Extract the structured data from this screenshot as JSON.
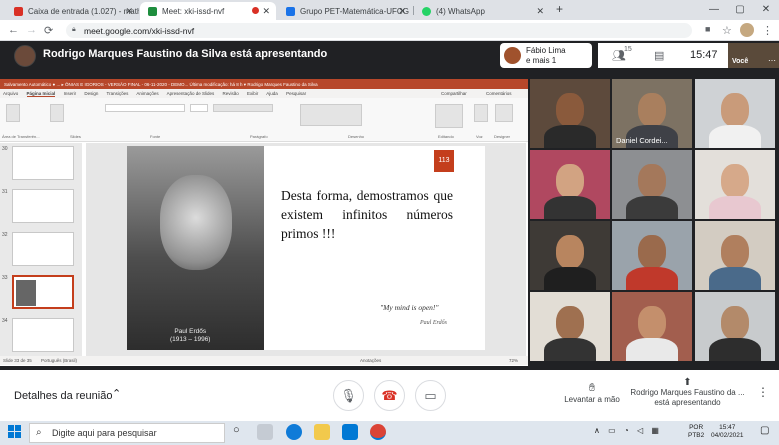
{
  "browser": {
    "tabs": [
      {
        "label": "Caixa de entrada (1.027) - mathe",
        "color": "#d93025"
      },
      {
        "label": "Meet: xki-issd-nvf",
        "color": "#1e8e3e"
      },
      {
        "label": "Grupo PET-Matemática-UFCG",
        "color": "#1a73e8"
      },
      {
        "label": "(4) WhatsApp",
        "color": "#25d366"
      }
    ],
    "url": "meet.google.com/xki-issd-nvf"
  },
  "meet": {
    "presenting_banner": "Rodrigo Marques Faustino da Silva está apresentando",
    "speaker_name": "Fábio Lima",
    "speaker_more": "e mais 1",
    "participant_count": "15",
    "time": "15:47",
    "self_label": "Você",
    "tile_name": "Daniel Cordei..."
  },
  "powerpoint": {
    "title_bar": "Salvamento Automático  ●  ...  ▸  ÕNIAS E IGORIOS - VERSÃO FINAL - 06-11-2020 - DEMO...   Última modificação: há 8 h  ▾    Rodrigo Marques Faustino da Silva",
    "menu": [
      "Arquivo",
      "Página Inicial",
      "Inserir",
      "Design",
      "Transições",
      "Animações",
      "Apresentação de Slides",
      "Revisão",
      "Exibir",
      "Ajuda",
      "Pesquisar",
      "Compartilhar",
      "Comentários"
    ],
    "groups": [
      "Área de Transferên...",
      "Slides",
      "Fonte",
      "Parágrafo",
      "Desenho",
      "Editando",
      "Voz",
      "Designer"
    ],
    "thumb_numbers": [
      "30",
      "31",
      "32",
      "33",
      "34"
    ],
    "slide": {
      "number": "113",
      "text": "Desta forma, demostramos que existem infinitos números primos !!!",
      "caption_name": "Paul Erdős",
      "caption_years": "(1913 – 1996)",
      "quote": "\"My mind is open!\"",
      "signature": "Paul Erdős"
    },
    "status_left": "Slide 33 de 35",
    "status_lang": "Português (Brasil)",
    "status_notes": "Anotações",
    "zoom": "72%"
  },
  "bottom": {
    "details_label": "Detalhes da reunião",
    "raise_hand": "Levantar a mão",
    "presenting": "Rodrigo Marques Faustino da ... está apresentando"
  },
  "taskbar": {
    "search_placeholder": "Digite aqui para pesquisar",
    "lang1": "POR",
    "lang2": "PTB2",
    "time": "15:47",
    "date": "04/02/2021"
  }
}
